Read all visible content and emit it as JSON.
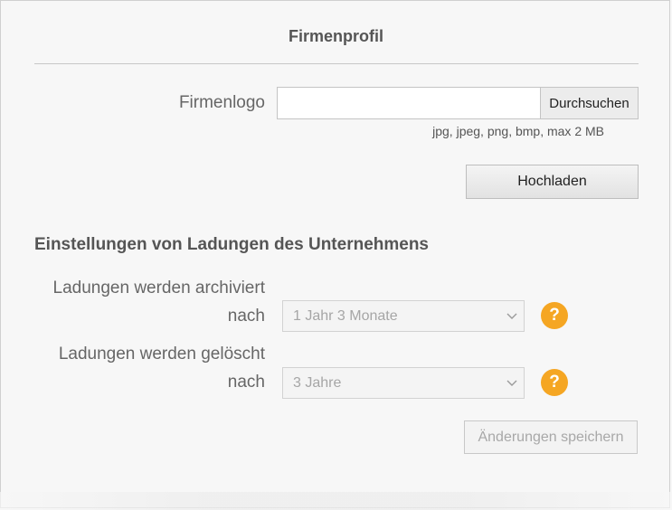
{
  "panel": {
    "title": "Firmenprofil"
  },
  "logo": {
    "label": "Firmenlogo",
    "file_value": "",
    "browse_label": "Durchsuchen",
    "hint": "jpg, jpeg, png, bmp, max 2 MB",
    "upload_label": "Hochladen"
  },
  "settings": {
    "heading": "Einstellungen von Ladungen des Unternehmens",
    "archive": {
      "label_line1": "Ladungen werden archiviert",
      "label_line2": "nach",
      "selected": "1 Jahr 3 Monate",
      "help_symbol": "?"
    },
    "delete": {
      "label_line1": "Ladungen werden gelöscht",
      "label_line2": "nach",
      "selected": "3 Jahre",
      "help_symbol": "?"
    },
    "save_label": "Änderungen speichern"
  },
  "colors": {
    "help_icon": "#f5a623",
    "background": "#f7f7f7"
  },
  "icons": {
    "help": "question-circle-icon",
    "dropdown": "chevron-down-icon"
  }
}
